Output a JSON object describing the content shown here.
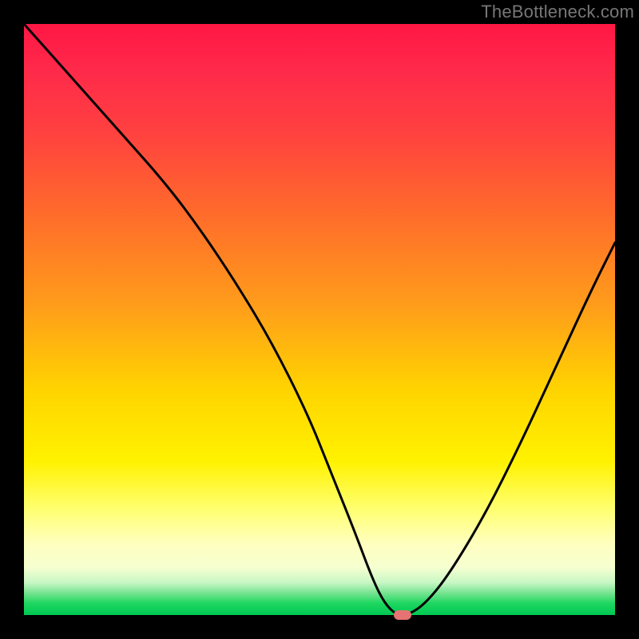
{
  "watermark": "TheBottleneck.com",
  "chart_data": {
    "type": "line",
    "title": "",
    "xlabel": "",
    "ylabel": "",
    "xlim": [
      0,
      100
    ],
    "ylim": [
      0,
      100
    ],
    "grid": false,
    "series": [
      {
        "name": "bottleneck-curve",
        "x": [
          0,
          8,
          16,
          24,
          30,
          36,
          42,
          48,
          52,
          56,
          59,
          61,
          63,
          65,
          68,
          72,
          78,
          84,
          90,
          96,
          100
        ],
        "values": [
          100,
          91,
          82,
          73,
          65,
          56,
          46,
          34,
          24,
          14,
          6,
          2,
          0,
          0,
          2,
          7,
          17,
          29,
          42,
          55,
          63
        ]
      }
    ],
    "annotations": [
      {
        "name": "optimal-marker",
        "x": 64,
        "y": 0
      }
    ],
    "background_gradient": {
      "top": "#ff1744",
      "mid": "#fff200",
      "bottom": "#00c853"
    }
  }
}
